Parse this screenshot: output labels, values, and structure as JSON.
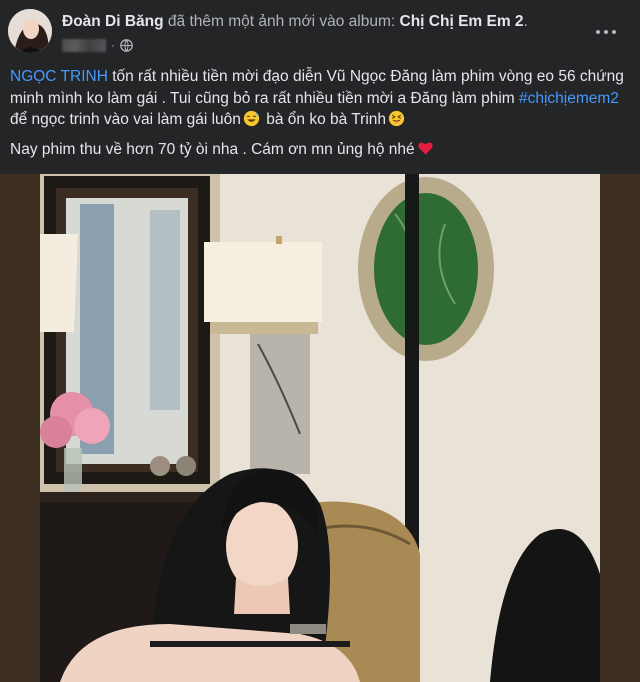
{
  "post": {
    "author_name": "Đoàn Di Băng",
    "action_text": " đã thêm một ảnh mới vào album: ",
    "album_name": "Chị Chị Em Em 2",
    "album_suffix": ".",
    "privacy_icon": "globe-icon",
    "more_icon": "more-horizontal-icon"
  },
  "body": {
    "mention": "NGỌC TRINH",
    "line1_rest": " tốn rất nhiều tiền mời đạo diễn Vũ Ngọc Đăng làm phim vòng eo 56 chứng minh mình ko làm gái . Tui cũng bỏ ra rất nhiều tiền mời a Đăng làm phim ",
    "hashtag": "#chịchịemem2",
    "line1_after_hashtag": " để ngọc trinh vào vai làm gái luôn",
    "line1_tail": "  bà ổn ko bà Trinh",
    "emoji_1": "sweat-smile-emoji",
    "emoji_2": "squint-tongue-emoji",
    "line2": "Nay phim thu về hơn 70 tỷ òi nha . Cám ơn mn ủng hộ nhé",
    "emoji_3": "red-heart-emoji"
  },
  "colors": {
    "background": "#242526",
    "text": "#e4e6eb",
    "secondary": "#b0b3b8",
    "link": "#4599ff",
    "heart": "#e41e3f"
  }
}
